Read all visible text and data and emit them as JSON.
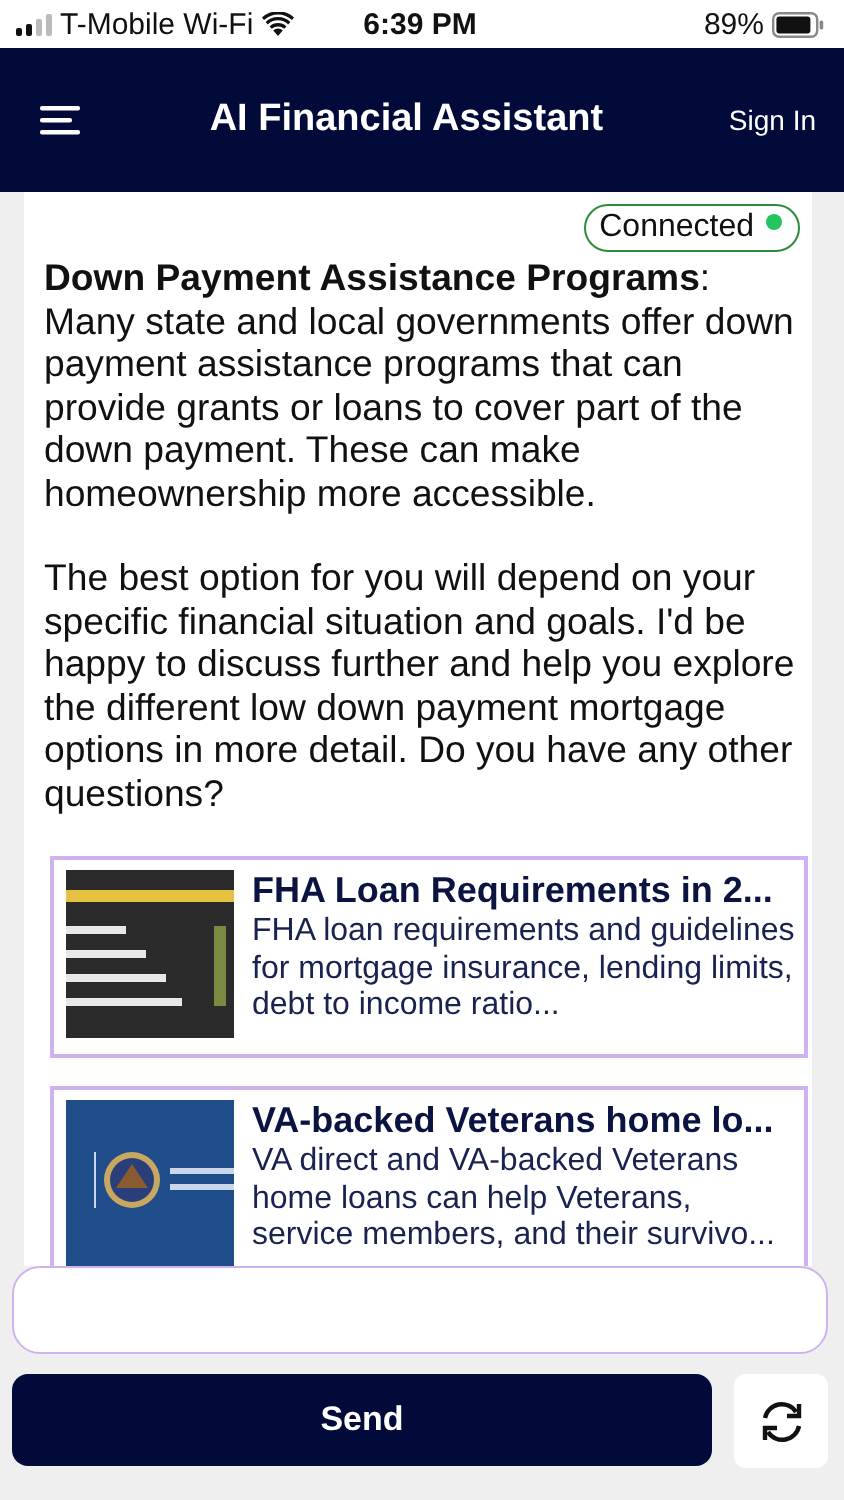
{
  "status_bar": {
    "carrier": "T-Mobile Wi-Fi",
    "time": "6:39 PM",
    "battery": "89%"
  },
  "header": {
    "title": "AI Financial Assistant",
    "sign_in": "Sign In"
  },
  "connection": {
    "label": "Connected",
    "connected": true
  },
  "message": {
    "paragraphs": [
      "**Down Payment Assistance Programs**: Many state and local governments offer down payment assistance programs that can provide grants or loans to cover part of the down payment. These can make homeownership more accessible.",
      "The best option for you will depend on your specific financial situation and goals. I'd be happy to discuss further and help you explore the different low down payment mortgage options in more detail. Do you have any other questions?"
    ]
  },
  "links": [
    {
      "title": "FHA Loan Requirements in 2...",
      "description": "FHA loan requirements and guidelines for mortgage insurance, lending limits, debt to income ratio...",
      "kind": "picture"
    },
    {
      "title": "VA-backed Veterans home lo...",
      "description": "VA direct and VA-backed Veterans home loans can help Veterans, service members, and their survivo...",
      "kind": "picture"
    }
  ],
  "composer": {
    "send": "Send"
  }
}
